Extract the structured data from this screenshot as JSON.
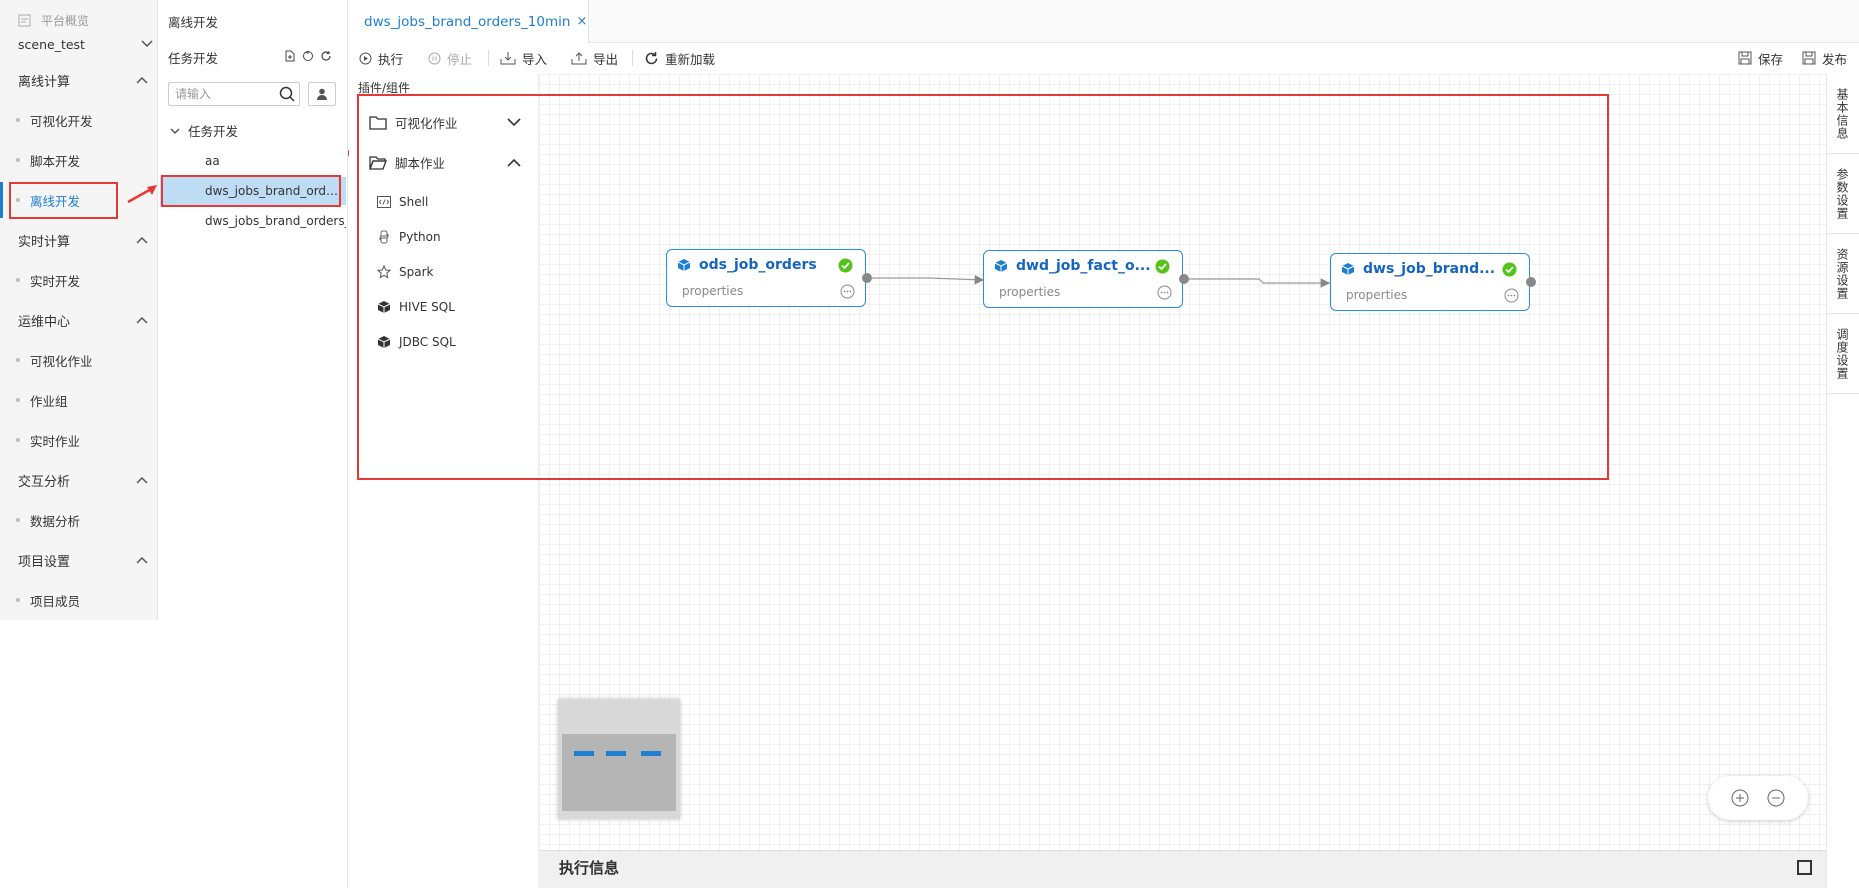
{
  "sidebar": {
    "overview": "平台概览",
    "project": "scene_test",
    "groups": [
      {
        "label": "离线计算",
        "items": [
          "可视化开发",
          "脚本开发",
          "离线开发"
        ]
      },
      {
        "label": "实时计算",
        "items": [
          "实时开发"
        ]
      },
      {
        "label": "运维中心",
        "items": [
          "可视化作业",
          "作业组",
          "实时作业"
        ]
      },
      {
        "label": "交互分析",
        "items": [
          "数据分析"
        ]
      },
      {
        "label": "项目设置",
        "items": [
          "项目成员"
        ]
      }
    ],
    "active_item": "离线开发"
  },
  "tree": {
    "title": "离线开发",
    "subtitle": "任务开发",
    "search_placeholder": "请输入",
    "root": "任务开发",
    "items": [
      "aa",
      "dws_jobs_brand_orders_10min",
      "dws_jobs_brand_orders_..."
    ],
    "selected": "dws_jobs_brand_orders_10min"
  },
  "tab": {
    "label": "dws_jobs_brand_orders_10min",
    "close": "×"
  },
  "toolbar": {
    "run": "执行",
    "stop": "停止",
    "import": "导入",
    "export": "导出",
    "reload": "重新加载",
    "save": "保存",
    "publish": "发布"
  },
  "palette": {
    "title": "插件/组件",
    "groups": [
      {
        "label": "可视化作业",
        "expanded": false
      },
      {
        "label": "脚本作业",
        "expanded": true
      }
    ],
    "items": [
      "Shell",
      "Python",
      "Spark",
      "HIVE SQL",
      "JDBC SQL"
    ]
  },
  "nodes": [
    {
      "name": "ods_job_orders",
      "props": "properties",
      "status": "success"
    },
    {
      "name": "dwd_job_fact_o...",
      "props": "properties",
      "status": "success"
    },
    {
      "name": "dws_job_brand...",
      "props": "properties",
      "status": "success"
    }
  ],
  "right_tabs": [
    "基本信息",
    "参数设置",
    "资源设置",
    "调度设置"
  ],
  "exec_panel": {
    "title": "执行信息"
  },
  "colors": {
    "accent": "#1e7fd1",
    "node_border": "#2d8ce0",
    "success": "#52c41a",
    "annotation": "#e53935"
  }
}
